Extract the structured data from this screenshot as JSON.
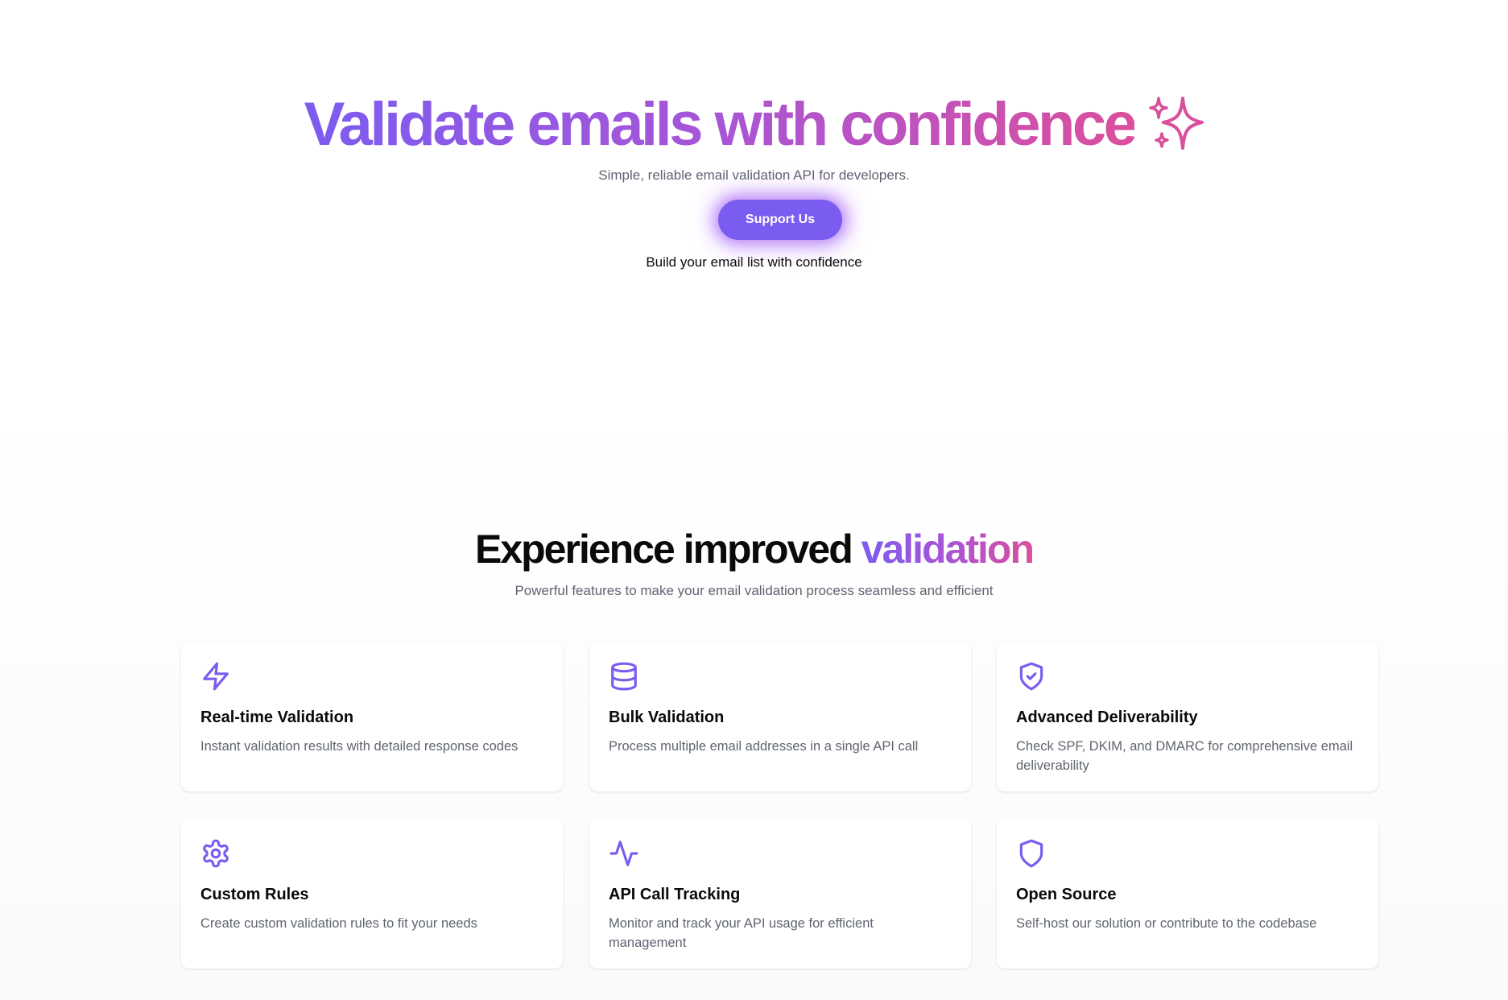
{
  "hero": {
    "title": "Validate emails with confidence",
    "subtitle": "Simple, reliable email validation API for developers.",
    "cta_label": "Support Us",
    "tagline": "Build your email list with confidence",
    "sparkle_icon": "sparkles-icon"
  },
  "features": {
    "title_prefix": "Experience improved ",
    "title_highlight": "validation",
    "subtitle": "Powerful features to make your email validation process seamless and efficient",
    "cards": [
      {
        "icon": "lightning-icon",
        "title": "Real-time Validation",
        "description": "Instant validation results with detailed response codes"
      },
      {
        "icon": "database-icon",
        "title": "Bulk Validation",
        "description": "Process multiple email addresses in a single API call"
      },
      {
        "icon": "shield-check-icon",
        "title": "Advanced Deliverability",
        "description": "Check SPF, DKIM, and DMARC for comprehensive email deliverability"
      },
      {
        "icon": "gear-icon",
        "title": "Custom Rules",
        "description": "Create custom validation rules to fit your needs"
      },
      {
        "icon": "activity-icon",
        "title": "API Call Tracking",
        "description": "Monitor and track your API usage for efficient management"
      },
      {
        "icon": "shield-icon",
        "title": "Open Source",
        "description": "Self-host our solution or contribute to the codebase"
      }
    ]
  },
  "colors": {
    "accent": "#7b5cf0",
    "gradient_start": "#7c5cf0",
    "gradient_end": "#db4f9c",
    "muted_text": "#5f6470"
  }
}
